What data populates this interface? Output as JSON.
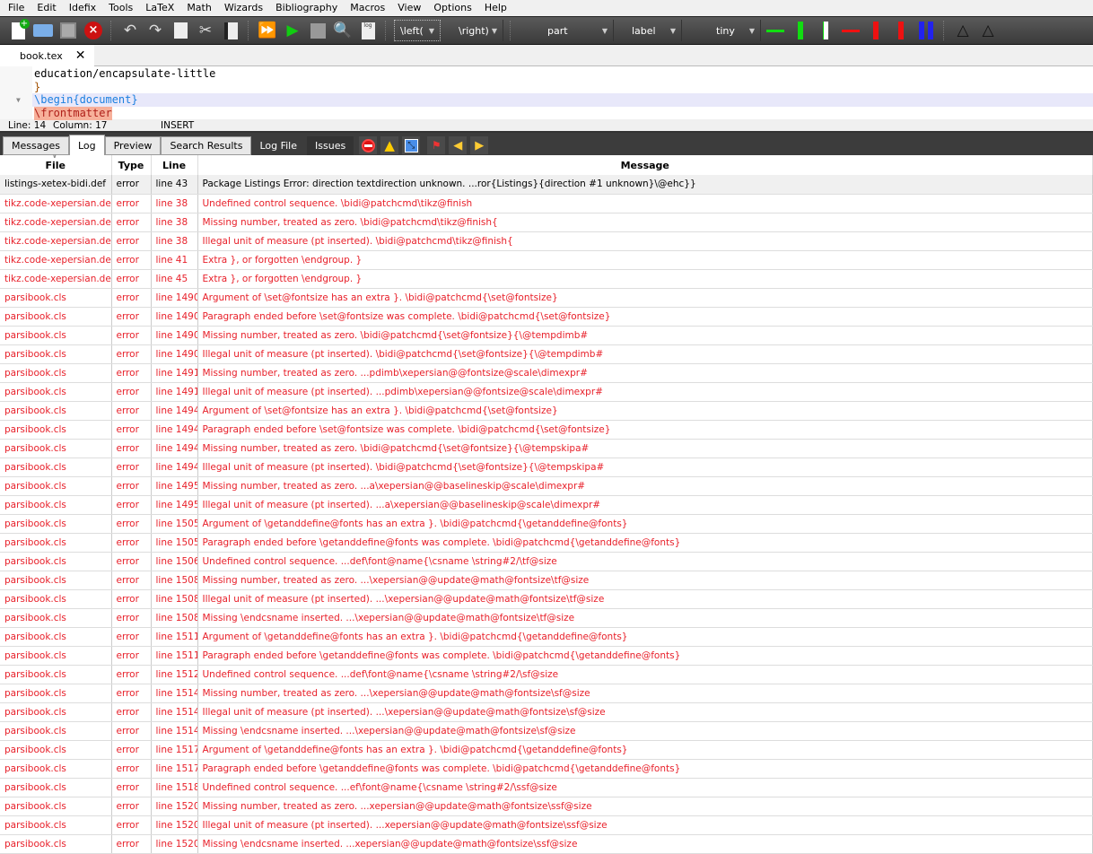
{
  "menu": [
    "File",
    "Edit",
    "Idefix",
    "Tools",
    "LaTeX",
    "Math",
    "Wizards",
    "Bibliography",
    "Macros",
    "View",
    "Options",
    "Help"
  ],
  "toolbar": {
    "combos": [
      "\\left(",
      "\\right)",
      "part",
      "label",
      "tiny"
    ]
  },
  "tab": {
    "label": "book.tex"
  },
  "editor": {
    "lines": [
      "education/encapsulate-little",
      "}",
      "\\begin{document}",
      "\\frontmatter"
    ]
  },
  "status": {
    "line": "Line: 14",
    "column": "Column: 17",
    "mode": "INSERT"
  },
  "panel": {
    "tabs": [
      "Messages",
      "Log",
      "Preview",
      "Search Results",
      "Log File",
      "Issues"
    ]
  },
  "log": {
    "columns": [
      "File",
      "Type",
      "Line",
      "Message"
    ],
    "rows": [
      [
        "listings-xetex-bidi.def",
        "error",
        "line 43",
        "Package Listings Error: direction textdirection unknown. ...ror{Listings}{direction #1 unknown}\\@ehc}}"
      ],
      [
        "tikz.code-xepersian.def",
        "error",
        "line 38",
        "Undefined control sequence. \\bidi@patchcmd\\tikz@finish"
      ],
      [
        "tikz.code-xepersian.def",
        "error",
        "line 38",
        "Missing number, treated as zero. \\bidi@patchcmd\\tikz@finish{"
      ],
      [
        "tikz.code-xepersian.def",
        "error",
        "line 38",
        "Illegal unit of measure (pt inserted). \\bidi@patchcmd\\tikz@finish{"
      ],
      [
        "tikz.code-xepersian.def",
        "error",
        "line 41",
        "Extra }, or forgotten \\endgroup. }"
      ],
      [
        "tikz.code-xepersian.def",
        "error",
        "line 45",
        "Extra }, or forgotten \\endgroup. }"
      ],
      [
        "parsibook.cls",
        "error",
        "line 1490",
        "Argument of \\set@fontsize has an extra }. \\bidi@patchcmd{\\set@fontsize}"
      ],
      [
        "parsibook.cls",
        "error",
        "line 1490",
        "Paragraph ended before \\set@fontsize was complete. \\bidi@patchcmd{\\set@fontsize}"
      ],
      [
        "parsibook.cls",
        "error",
        "line 1490",
        "Missing number, treated as zero. \\bidi@patchcmd{\\set@fontsize}{\\@tempdimb#"
      ],
      [
        "parsibook.cls",
        "error",
        "line 1490",
        "Illegal unit of measure (pt inserted). \\bidi@patchcmd{\\set@fontsize}{\\@tempdimb#"
      ],
      [
        "parsibook.cls",
        "error",
        "line 1491",
        "Missing number, treated as zero. ...pdimb\\xepersian@@fontsize@scale\\dimexpr#"
      ],
      [
        "parsibook.cls",
        "error",
        "line 1491",
        "Illegal unit of measure (pt inserted). ...pdimb\\xepersian@@fontsize@scale\\dimexpr#"
      ],
      [
        "parsibook.cls",
        "error",
        "line 1494",
        "Argument of \\set@fontsize has an extra }. \\bidi@patchcmd{\\set@fontsize}"
      ],
      [
        "parsibook.cls",
        "error",
        "line 1494",
        "Paragraph ended before \\set@fontsize was complete. \\bidi@patchcmd{\\set@fontsize}"
      ],
      [
        "parsibook.cls",
        "error",
        "line 1494",
        "Missing number, treated as zero. \\bidi@patchcmd{\\set@fontsize}{\\@tempskipa#"
      ],
      [
        "parsibook.cls",
        "error",
        "line 1494",
        "Illegal unit of measure (pt inserted). \\bidi@patchcmd{\\set@fontsize}{\\@tempskipa#"
      ],
      [
        "parsibook.cls",
        "error",
        "line 1495",
        "Missing number, treated as zero. ...a\\xepersian@@baselineskip@scale\\dimexpr#"
      ],
      [
        "parsibook.cls",
        "error",
        "line 1495",
        "Illegal unit of measure (pt inserted). ...a\\xepersian@@baselineskip@scale\\dimexpr#"
      ],
      [
        "parsibook.cls",
        "error",
        "line 1505",
        "Argument of \\getanddefine@fonts has an extra }. \\bidi@patchcmd{\\getanddefine@fonts}"
      ],
      [
        "parsibook.cls",
        "error",
        "line 1505",
        "Paragraph ended before \\getanddefine@fonts was complete. \\bidi@patchcmd{\\getanddefine@fonts}"
      ],
      [
        "parsibook.cls",
        "error",
        "line 1506",
        "Undefined control sequence. ...def\\font@name{\\csname \\string#2/\\tf@size"
      ],
      [
        "parsibook.cls",
        "error",
        "line 1508",
        "Missing number, treated as zero. ...\\xepersian@@update@math@fontsize\\tf@size"
      ],
      [
        "parsibook.cls",
        "error",
        "line 1508",
        "Illegal unit of measure (pt inserted). ...\\xepersian@@update@math@fontsize\\tf@size"
      ],
      [
        "parsibook.cls",
        "error",
        "line 1508",
        "Missing \\endcsname inserted. ...\\xepersian@@update@math@fontsize\\tf@size"
      ],
      [
        "parsibook.cls",
        "error",
        "line 1511",
        "Argument of \\getanddefine@fonts has an extra }. \\bidi@patchcmd{\\getanddefine@fonts}"
      ],
      [
        "parsibook.cls",
        "error",
        "line 1511",
        "Paragraph ended before \\getanddefine@fonts was complete. \\bidi@patchcmd{\\getanddefine@fonts}"
      ],
      [
        "parsibook.cls",
        "error",
        "line 1512",
        "Undefined control sequence. ...def\\font@name{\\csname \\string#2/\\sf@size"
      ],
      [
        "parsibook.cls",
        "error",
        "line 1514",
        "Missing number, treated as zero. ...\\xepersian@@update@math@fontsize\\sf@size"
      ],
      [
        "parsibook.cls",
        "error",
        "line 1514",
        "Illegal unit of measure (pt inserted). ...\\xepersian@@update@math@fontsize\\sf@size"
      ],
      [
        "parsibook.cls",
        "error",
        "line 1514",
        "Missing \\endcsname inserted. ...\\xepersian@@update@math@fontsize\\sf@size"
      ],
      [
        "parsibook.cls",
        "error",
        "line 1517",
        "Argument of \\getanddefine@fonts has an extra }. \\bidi@patchcmd{\\getanddefine@fonts}"
      ],
      [
        "parsibook.cls",
        "error",
        "line 1517",
        "Paragraph ended before \\getanddefine@fonts was complete. \\bidi@patchcmd{\\getanddefine@fonts}"
      ],
      [
        "parsibook.cls",
        "error",
        "line 1518",
        "Undefined control sequence. ...ef\\font@name{\\csname \\string#2/\\ssf@size"
      ],
      [
        "parsibook.cls",
        "error",
        "line 1520",
        "Missing number, treated as zero. ...xepersian@@update@math@fontsize\\ssf@size"
      ],
      [
        "parsibook.cls",
        "error",
        "line 1520",
        "Illegal unit of measure (pt inserted). ...xepersian@@update@math@fontsize\\ssf@size"
      ],
      [
        "parsibook.cls",
        "error",
        "line 1520",
        "Missing \\endcsname inserted. ...xepersian@@update@math@fontsize\\ssf@size"
      ]
    ]
  },
  "colors": {
    "error": "#e8202a",
    "toolbar": "#444444",
    "highlight": "#e8e8fa",
    "frontmatter_bg": "#f7b09a"
  }
}
